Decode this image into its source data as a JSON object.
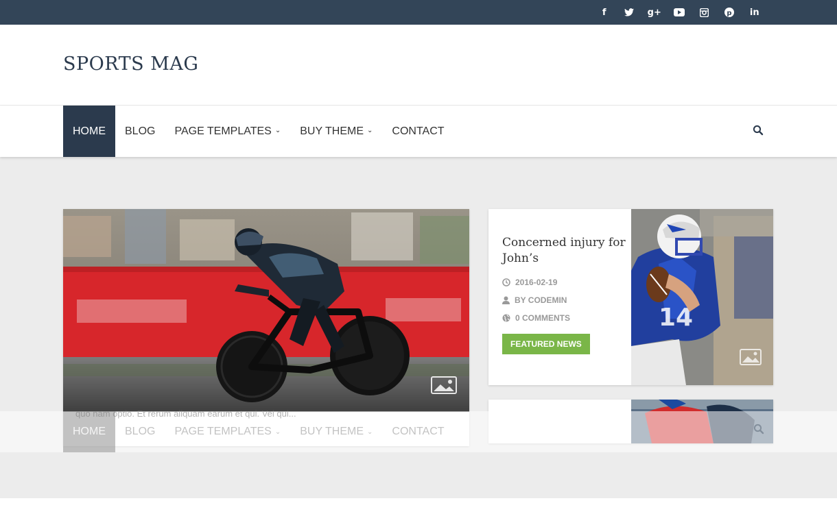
{
  "topbar": {
    "social": [
      {
        "icon": "facebook-icon",
        "glyph": "f"
      },
      {
        "icon": "twitter-icon",
        "glyph": "t"
      },
      {
        "icon": "google-plus-icon",
        "glyph": "g+"
      },
      {
        "icon": "youtube-icon",
        "glyph": "▶"
      },
      {
        "icon": "instagram-icon",
        "glyph": "◎"
      },
      {
        "icon": "pinterest-icon",
        "glyph": "p"
      },
      {
        "icon": "linkedin-icon",
        "glyph": "in"
      }
    ]
  },
  "header": {
    "logo": "SPORTS MAG"
  },
  "nav": {
    "items": [
      {
        "label": "HOME",
        "active": true
      },
      {
        "label": "BLOG"
      },
      {
        "label": "PAGE TEMPLATES",
        "caret": "⌄"
      },
      {
        "label": "BUY THEME",
        "caret": "⌄"
      },
      {
        "label": "CONTACT"
      }
    ]
  },
  "main_post": {
    "excerpt": "quo nam optio. Et rerum aliquam earum et qui. Vel qui..."
  },
  "side_post": {
    "title": "Concerned injury for John’s",
    "date": "2016-02-19",
    "author": "BY CODEMIN",
    "comments": "0 COMMENTS",
    "badge": "FEATURED NEWS"
  },
  "colors": {
    "primary": "#2b3a4d",
    "topbar": "#334558",
    "badge": "#7ab648",
    "band": "#ececec"
  }
}
